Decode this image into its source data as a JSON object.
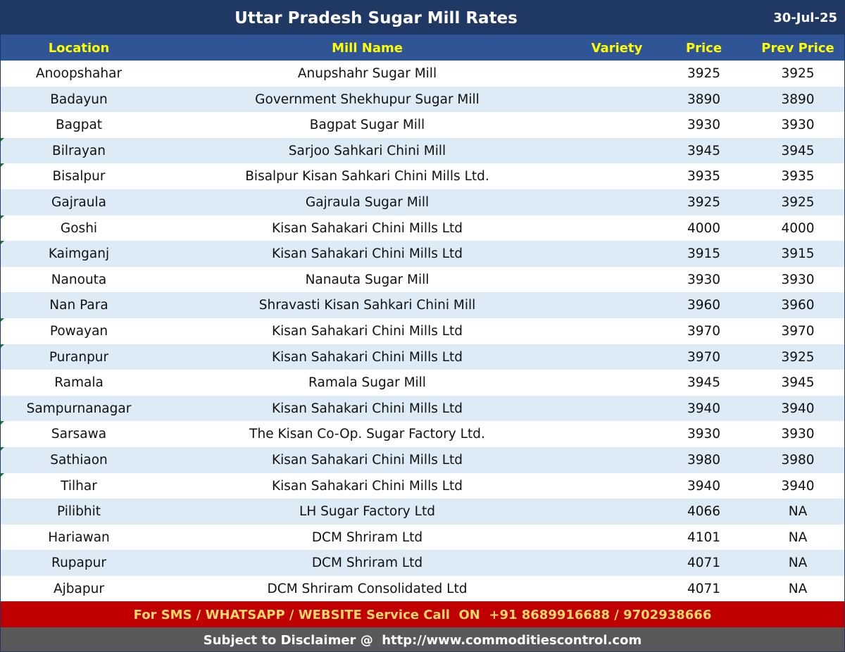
{
  "title": "Uttar Pradesh Sugar Mill Rates",
  "date": "30-Jul-25",
  "columns": {
    "location": "Location",
    "mill": "Mill Name",
    "variety": "Variety",
    "price": "Price",
    "prev": "Prev Price"
  },
  "rows": [
    {
      "location": "Anoopshahar",
      "mill": "Anupshahr Sugar Mill",
      "variety": "",
      "price": "3925",
      "prev": "3925"
    },
    {
      "location": "Badayun",
      "mill": "Government Shekhupur Sugar Mill",
      "variety": "",
      "price": "3890",
      "prev": "3890"
    },
    {
      "location": "Bagpat",
      "mill": "Bagpat Sugar Mill",
      "variety": "",
      "price": "3930",
      "prev": "3930"
    },
    {
      "location": "Bilrayan",
      "mill": "Sarjoo Sahkari Chini Mill",
      "variety": "",
      "price": "3945",
      "prev": "3945"
    },
    {
      "location": "Bisalpur",
      "mill": "Bisalpur Kisan Sahkari Chini Mills Ltd.",
      "variety": "",
      "price": "3935",
      "prev": "3935"
    },
    {
      "location": "Gajraula",
      "mill": "Gajraula Sugar Mill",
      "variety": "",
      "price": "3925",
      "prev": "3925"
    },
    {
      "location": "Goshi",
      "mill": "Kisan Sahakari Chini Mills Ltd",
      "variety": "",
      "price": "4000",
      "prev": "4000"
    },
    {
      "location": "Kaimganj",
      "mill": "Kisan Sahakari Chini Mills Ltd",
      "variety": "",
      "price": "3915",
      "prev": "3915"
    },
    {
      "location": "Nanouta",
      "mill": "Nanauta Sugar Mill",
      "variety": "",
      "price": "3930",
      "prev": "3930"
    },
    {
      "location": "Nan Para",
      "mill": "Shravasti Kisan Sahkari Chini Mill",
      "variety": "",
      "price": "3960",
      "prev": "3960"
    },
    {
      "location": "Powayan",
      "mill": "Kisan Sahakari Chini Mills Ltd",
      "variety": "",
      "price": "3970",
      "prev": "3970"
    },
    {
      "location": "Puranpur",
      "mill": "Kisan Sahakari Chini Mills Ltd",
      "variety": "",
      "price": "3970",
      "prev": "3925"
    },
    {
      "location": "Ramala",
      "mill": "Ramala Sugar Mill",
      "variety": "",
      "price": "3945",
      "prev": "3945"
    },
    {
      "location": "Sampurnanagar",
      "mill": "Kisan Sahakari Chini Mills Ltd",
      "variety": "",
      "price": "3940",
      "prev": "3940"
    },
    {
      "location": "Sarsawa",
      "mill": "The Kisan Co-Op. Sugar Factory Ltd.",
      "variety": "",
      "price": "3930",
      "prev": "3930"
    },
    {
      "location": "Sathiaon",
      "mill": "Kisan Sahakari Chini Mills Ltd",
      "variety": "",
      "price": "3980",
      "prev": "3980"
    },
    {
      "location": "Tilhar",
      "mill": "Kisan Sahakari Chini Mills Ltd",
      "variety": "",
      "price": "3940",
      "prev": "3940"
    },
    {
      "location": "Pilibhit",
      "mill": "LH Sugar Factory Ltd",
      "variety": "",
      "price": "4066",
      "prev": "NA"
    },
    {
      "location": "Hariawan",
      "mill": "DCM Shriram Ltd",
      "variety": "",
      "price": "4101",
      "prev": "NA"
    },
    {
      "location": "Rupapur",
      "mill": "DCM Shriram Ltd",
      "variety": "",
      "price": "4071",
      "prev": "NA"
    },
    {
      "location": "Ajbapur",
      "mill": "DCM Shriram Consolidated Ltd",
      "variety": "",
      "price": "4071",
      "prev": "NA"
    }
  ],
  "footer": {
    "service": "For SMS / WHATSAPP / WEBSITE Service Call  ON  +91 8689916688 / 9702938666",
    "disclaimer": "Subject to Disclaimer @  http://www.commoditiescontrol.com"
  },
  "colors": {
    "title_bg": "#1f3864",
    "header_bg": "#2f5597",
    "header_text": "#ffff00",
    "alt_row": "#ddebf7",
    "service_bg": "#c00000",
    "service_text": "#ffd966",
    "disclaimer_bg": "#595959"
  }
}
